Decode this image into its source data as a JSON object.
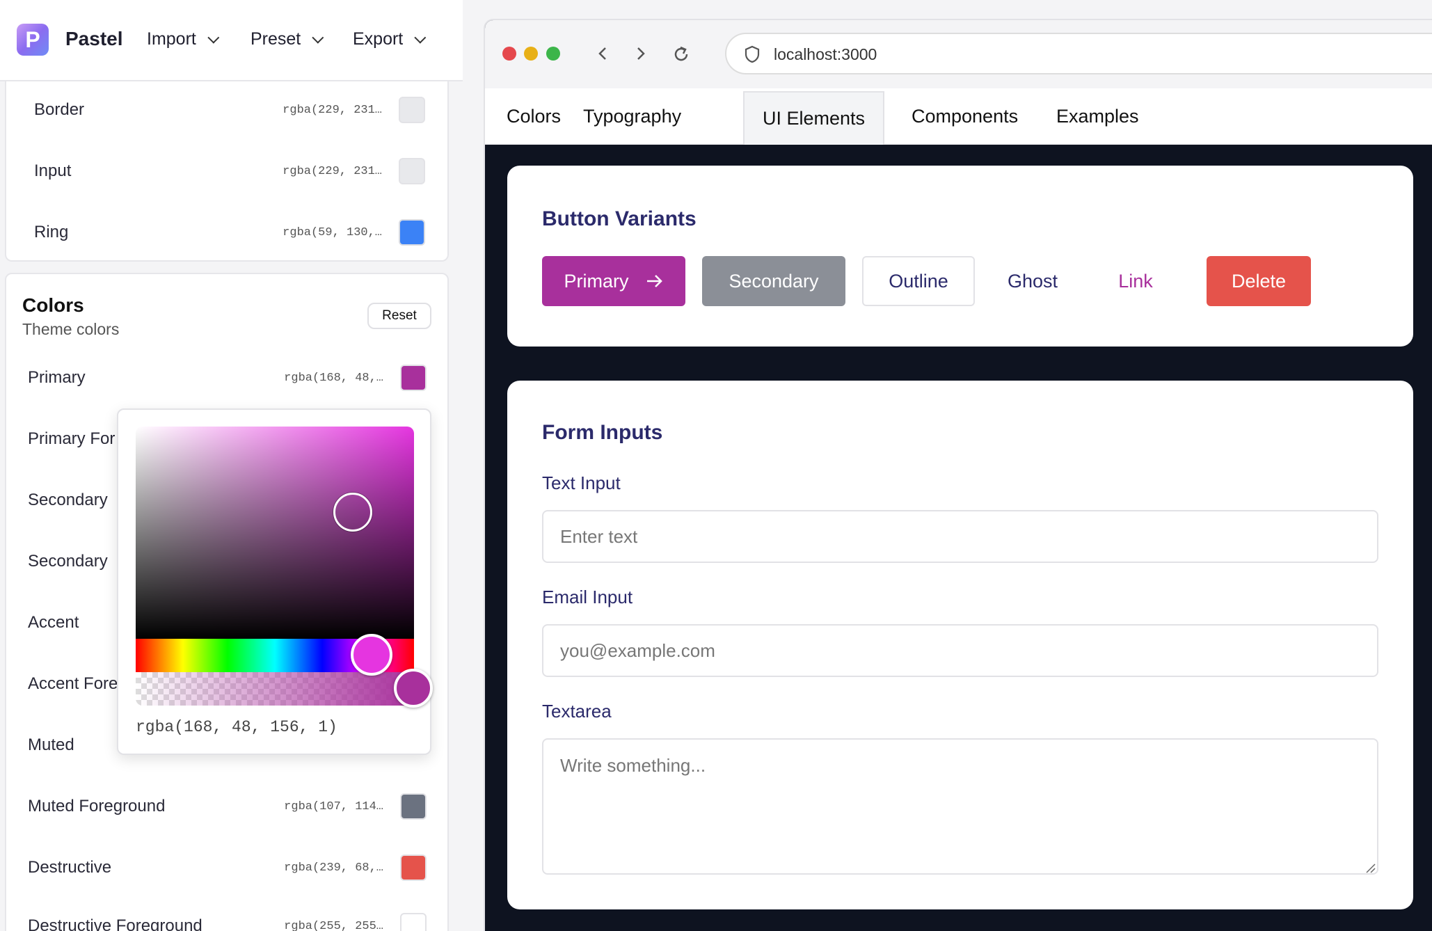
{
  "app": {
    "name": "Pastel",
    "logo_letter": "P",
    "menus": [
      {
        "label": "Import"
      },
      {
        "label": "Preset"
      },
      {
        "label": "Export"
      }
    ]
  },
  "base_rows": [
    {
      "label": "Border",
      "value": "rgba(229, 231…",
      "color": "#e5e7eb"
    },
    {
      "label": "Input",
      "value": "rgba(229, 231…",
      "color": "#e5e7eb"
    },
    {
      "label": "Ring",
      "value": "rgba(59, 130,…",
      "color": "#3b82f6"
    }
  ],
  "colors_section": {
    "title": "Colors",
    "subtitle": "Theme colors",
    "reset_label": "Reset",
    "rows": [
      {
        "label": "Primary",
        "value": "rgba(168, 48,…",
        "color": "#a8309c"
      },
      {
        "label": "Primary For",
        "value": "",
        "color": ""
      },
      {
        "label": "Secondary",
        "value": "",
        "color": ""
      },
      {
        "label": "Secondary",
        "value": "",
        "color": ""
      },
      {
        "label": "Accent",
        "value": "",
        "color": ""
      },
      {
        "label": "Accent Fore",
        "value": "",
        "color": ""
      },
      {
        "label": "Muted",
        "value": "",
        "color": ""
      },
      {
        "label": "Muted Foreground",
        "value": "rgba(107, 114…",
        "color": "#6b7280"
      },
      {
        "label": "Destructive",
        "value": "rgba(239, 68,…",
        "color": "#e5534b"
      },
      {
        "label": "Destructive Foreground",
        "value": "rgba(255, 255…",
        "color": "#ffffff"
      }
    ]
  },
  "picker": {
    "value": "rgba(168, 48, 156, 1)",
    "hue_color": "#e535e0",
    "alpha": 1.0
  },
  "browser": {
    "url": "localhost:3000",
    "tabs": [
      {
        "label": "Colors"
      },
      {
        "label": "Typography"
      },
      {
        "label": "UI Elements"
      },
      {
        "label": "Components"
      },
      {
        "label": "Examples"
      }
    ],
    "active_tab": "UI Elements"
  },
  "buttons_section": {
    "title": "Button Variants",
    "buttons": {
      "primary": "Primary",
      "secondary": "Secondary",
      "outline": "Outline",
      "ghost": "Ghost",
      "link": "Link",
      "delete": "Delete"
    },
    "colors": {
      "primary": "#a8309c",
      "secondary": "#8b8f97",
      "destructive": "#e5534b",
      "text_dark": "#2b2a6b"
    }
  },
  "form_section": {
    "title": "Form Inputs",
    "text_label": "Text Input",
    "text_placeholder": "Enter text",
    "email_label": "Email Input",
    "email_placeholder": "you@example.com",
    "textarea_label": "Textarea",
    "textarea_placeholder": "Write something..."
  }
}
